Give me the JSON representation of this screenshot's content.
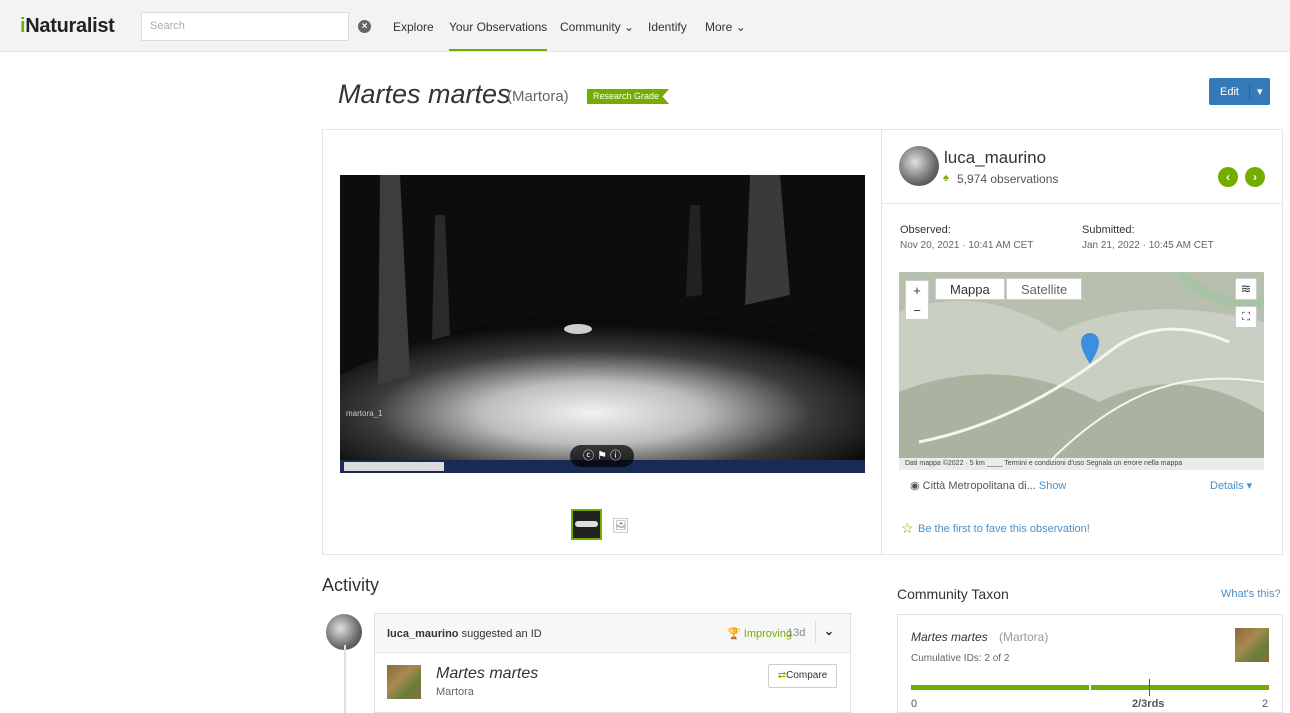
{
  "header": {
    "logo": "Naturalist",
    "logo_i": "i",
    "search_placeholder": "Search",
    "nav": [
      "Explore",
      "Your Observations",
      "Community",
      "Identify",
      "More"
    ]
  },
  "observation": {
    "scientific_name": "Martes martes",
    "common_name": "(Martora)",
    "grade": "Research Grade",
    "edit_label": "Edit",
    "photo_caption": "martora_1"
  },
  "observer": {
    "username": "luca_maurino",
    "observations": "5,974 observations"
  },
  "dates": {
    "observed_label": "Observed:",
    "observed_value": "Nov 20, 2021 · 10:41 AM CET",
    "submitted_label": "Submitted:",
    "submitted_value": "Jan 21, 2022 · 10:45 AM CET"
  },
  "map": {
    "tab_map": "Mappa",
    "tab_satellite": "Satellite",
    "attribution": "Dati mappa ©2022 · 5 km ____   Termini e condizioni d'uso   Segnala un errore nella mappa",
    "place": "Città Metropolitana di...",
    "show": "Show",
    "details": "Details ▾"
  },
  "fave_text": "Be the first to fave this observation!",
  "activity": {
    "heading": "Activity",
    "user": "luca_maurino",
    "action": " suggested an ID",
    "status": "Improving",
    "age": "13d",
    "taxon_sci": "Martes martes",
    "taxon_common": "Martora",
    "compare": "Compare"
  },
  "community_taxon": {
    "heading": "Community Taxon",
    "whats_this": "What's this?",
    "sci": "Martes martes",
    "common": "(Martora)",
    "cumulative": "Cumulative IDs: 2 of 2",
    "axis_min": "0",
    "axis_mid": "2/3rds",
    "axis_max": "2"
  },
  "colors": {
    "accent": "#74ac00",
    "link": "#4a90c8",
    "primary": "#337ab7"
  }
}
